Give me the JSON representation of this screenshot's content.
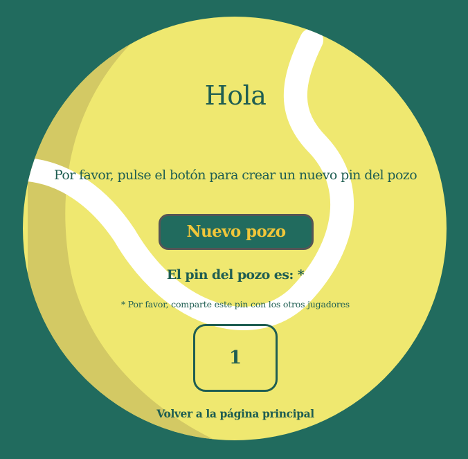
{
  "colors": {
    "background": "#216b5e",
    "ball": "#efe870",
    "ball_shadow": "#d3c964",
    "seam": "#ffffff",
    "text": "#1f5e52",
    "button_text": "#f0c63a"
  },
  "page": {
    "title": "Hola",
    "instruction": "Por favor, pulse el botón para crear un nuevo pin del pozo",
    "new_button_label": "Nuevo pozo",
    "pin_label": "El pin del pozo es: *",
    "note": "* Por favor, comparte este pin con los otros jugadores",
    "pin_value": "1",
    "back_link": "Volver a la página principal"
  },
  "decorations": {
    "ball_icon": "tennis-ball-icon"
  }
}
